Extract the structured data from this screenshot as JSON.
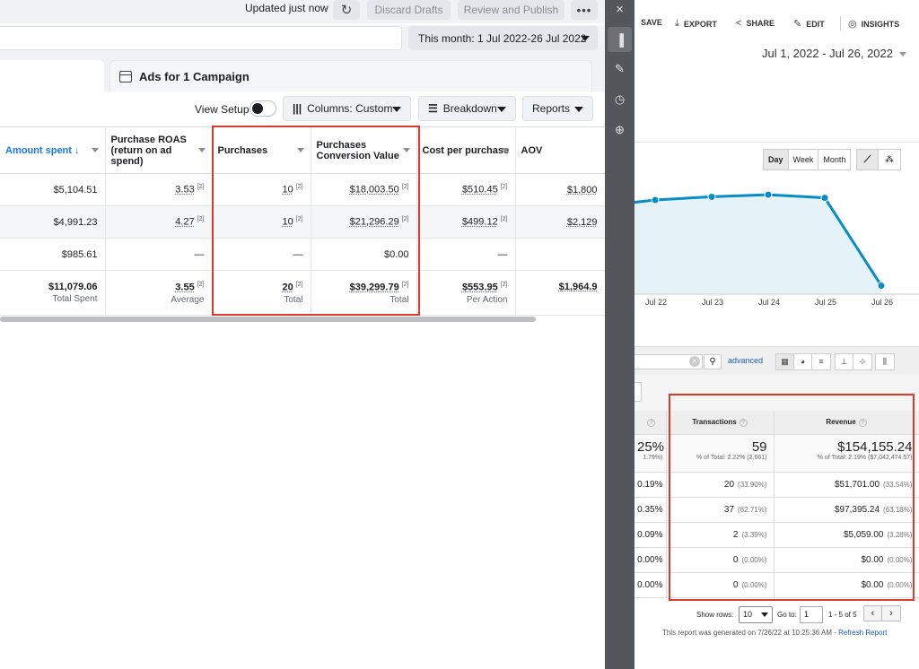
{
  "ads_manager": {
    "status": "Updated just now",
    "buttons": {
      "discard": "Discard Drafts",
      "review": "Review and Publish",
      "more": "•••"
    },
    "date_range": "This month: 1 Jul 2022-26 Jul 2022",
    "tab_title": "Ads for 1 Campaign",
    "toolbar": {
      "view_setup": "View Setup",
      "columns": "Columns: Custom",
      "breakdown": "Breakdown",
      "reports": "Reports"
    },
    "table": {
      "headers": [
        "Amount spent ↓",
        "Purchase ROAS (return on ad spend)",
        "Purchases",
        "Purchases Conversion Value",
        "Cost per purchase",
        "AOV"
      ],
      "attribution_mark": "[2]",
      "rows": [
        {
          "amount": "$5,104.51",
          "roas": "3.53",
          "purchases": "10",
          "conv_value": "$18,003.50",
          "cost": "$510.45",
          "aov": "$1,800"
        },
        {
          "amount": "$4,991.23",
          "roas": "4.27",
          "purchases": "10",
          "conv_value": "$21,296.29",
          "cost": "$499.12",
          "aov": "$2,129"
        },
        {
          "amount": "$985.61",
          "roas": "—",
          "purchases": "—",
          "conv_value": "$0.00",
          "cost": "—",
          "aov": ""
        }
      ],
      "totals": {
        "amount": "$11,079.06",
        "amount_label": "Total Spent",
        "roas": "3.55",
        "roas_label": "Average",
        "purchases": "20",
        "purchases_label": "Total",
        "conv_value": "$39,299.79",
        "conv_label": "Total",
        "cost": "$553.95",
        "cost_label": "Per Action",
        "aov": "$1,964.9"
      }
    }
  },
  "analytics": {
    "toolbar": {
      "save": "SAVE",
      "export": "EXPORT",
      "share": "SHARE",
      "edit": "EDIT",
      "insights": "INSIGHTS"
    },
    "date_range": "Jul 1, 2022 - Jul 26, 2022",
    "granularity": [
      "Day",
      "Week",
      "Month"
    ],
    "chart_data": {
      "type": "area",
      "x": [
        "Jul 22",
        "Jul 23",
        "Jul 24",
        "Jul 25",
        "Jul 26"
      ],
      "points": [
        {
          "x": "Jul 21",
          "y": 0.84
        },
        {
          "x": "Jul 22",
          "y": 0.89
        },
        {
          "x": "Jul 23",
          "y": 0.92
        },
        {
          "x": "Jul 24",
          "y": 0.94
        },
        {
          "x": "Jul 25",
          "y": 0.91
        },
        {
          "x": "Jul 26",
          "y": 0.08
        }
      ],
      "color": "#058dc7",
      "fill": "#e5f3f9"
    },
    "search": {
      "clear": "×",
      "advanced": "advanced"
    },
    "table": {
      "col_left_header": "",
      "transactions_header": "Transactions",
      "revenue_header": "Revenue",
      "totals": {
        "left": "25%",
        "left_sub": "1.79%)",
        "transactions": "59",
        "transactions_pct": "% of Total: 2.22% (2,661)",
        "revenue": "$154,155.24",
        "revenue_pct": "% of Total: 2.19% ($7,042,474.57)"
      },
      "rows": [
        {
          "left": "0.19%",
          "transactions": "20",
          "t_pct": "(33.90%)",
          "revenue": "$51,701.00",
          "r_pct": "(33.54%)"
        },
        {
          "left": "0.35%",
          "transactions": "37",
          "t_pct": "(62.71%)",
          "revenue": "$97,395.24",
          "r_pct": "(63.18%)"
        },
        {
          "left": "0.09%",
          "transactions": "2",
          "t_pct": "(3.39%)",
          "revenue": "$5,059.00",
          "r_pct": "(3.28%)"
        },
        {
          "left": "0.00%",
          "transactions": "0",
          "t_pct": "(0.00%)",
          "revenue": "$0.00",
          "r_pct": "(0.00%)"
        },
        {
          "left": "0.00%",
          "transactions": "0",
          "t_pct": "(0.00%)",
          "revenue": "$0.00",
          "r_pct": "(0.00%)"
        }
      ]
    },
    "footer": {
      "show_rows": "Show rows:",
      "rows_value": "10",
      "go_to": "Go to:",
      "go_to_value": "1",
      "range": "1 - 5 of 5",
      "generated": "This report was generated on 7/26/22 at 10:25:36 AM - ",
      "refresh": "Refresh Report"
    }
  },
  "colors": {
    "highlight": "#e0392c",
    "fb_blue": "#1877f2",
    "ga_blue": "#058dc7"
  }
}
